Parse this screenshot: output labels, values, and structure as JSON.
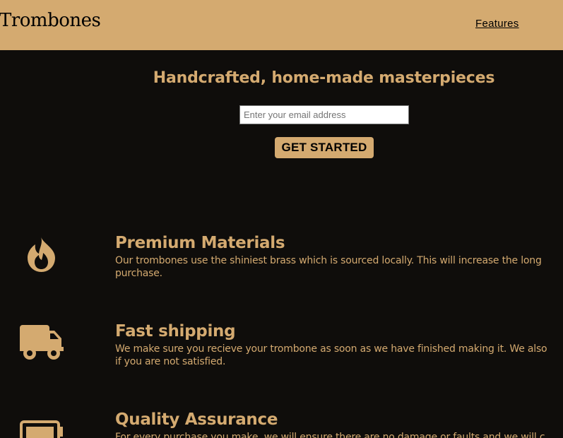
{
  "header": {
    "logo_text": "Trombones",
    "nav": {
      "features_label": "Features"
    }
  },
  "hero": {
    "title": "Handcrafted, home-made masterpieces",
    "email_placeholder": "Enter your email address",
    "cta_label": "GET STARTED"
  },
  "features": [
    {
      "icon": "fire-icon",
      "title": "Premium Materials",
      "text_line1": "Our trombones use the shiniest brass which is sourced locally. This will increase the long",
      "text_line2": "purchase."
    },
    {
      "icon": "truck-icon",
      "title": "Fast shipping",
      "text_line1": "We make sure you recieve your trombone as soon as we have finished making it. We also",
      "text_line2": "if you are not satisfied."
    },
    {
      "icon": "battery-full-icon",
      "title": "Quality Assurance",
      "text_line1": "For every purchase you make, we will ensure there are no damage or faults and we will c"
    }
  ],
  "colors": {
    "accent": "#d4aa70",
    "background": "#0f0d0b",
    "header_text": "#000000"
  }
}
